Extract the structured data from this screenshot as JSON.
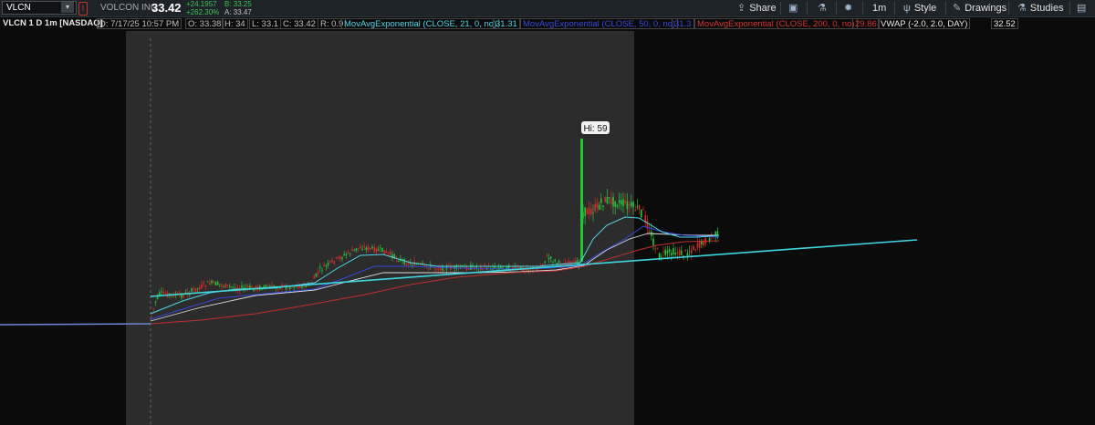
{
  "toolbar": {
    "symbol": "VLCN",
    "company": "VOLCON INC",
    "price": "33.42",
    "change_abs": "+24.1957",
    "change_pct": "+262.30%",
    "bid": "B: 33.25",
    "ask": "A: 33.47",
    "share_label": "Share",
    "timeframe_label": "1m",
    "style_label": "Style",
    "drawings_label": "Drawings",
    "studies_label": "Studies"
  },
  "infobar": {
    "title": "VLCN 1 D 1m [NASDAQ]",
    "date": "D: 7/17/25 10:57 PM",
    "open": "O: 33.38",
    "high": "H: 34",
    "low": "L: 33.1",
    "close": "C: 33.42",
    "range": "R: 0.9",
    "ema21_label": "MovAvgExponential (CLOSE, 21, 0, no)",
    "ema21_value": "31.31",
    "ema50_label": "MovAvgExponential (CLOSE, 50, 0, no)",
    "ema50_value": "31.3",
    "ema200_label": "MovAvgExponential (CLOSE, 200, 0, no)",
    "ema200_value": "29.86",
    "vwap_label": "VWAP (-2.0, 2.0, DAY)",
    "vwap_value": "32.52"
  },
  "chart": {
    "hi_label": "Hi: 59",
    "colors": {
      "up": "#26c23a",
      "down": "#d22a2a",
      "ema21": "#4fd5e8",
      "ema50": "#3848d8",
      "ema200": "#c03030",
      "vwap": "#dcdcdc",
      "trendline": "#3fd6e0",
      "session_bg": "#2c2c2c",
      "after_hours_bg": "#0b0b0b"
    }
  }
}
